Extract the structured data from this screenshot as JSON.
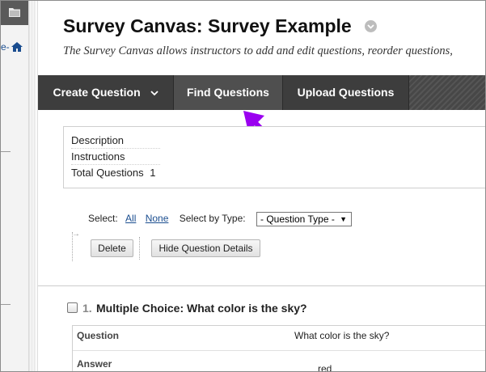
{
  "left_nav": {
    "cut_text": "e-",
    "icons": {
      "folder": "folder-icon",
      "home": "home-icon"
    }
  },
  "page": {
    "title": "Survey Canvas: Survey Example",
    "description": "The Survey Canvas allows instructors to add and edit questions, reorder questions,",
    "help_icon": "chevron-down-circle-icon"
  },
  "toolbar": {
    "create_question": "Create Question",
    "find_questions": "Find Questions",
    "upload_questions": "Upload Questions"
  },
  "annotation": {
    "arrow_color": "#9b00f0"
  },
  "summary": {
    "description_label": "Description",
    "instructions_label": "Instructions",
    "total_questions_label": "Total Questions",
    "total_questions_value": "1"
  },
  "selection": {
    "select_label": "Select:",
    "all_link": "All",
    "none_link": "None",
    "select_by_type_label": "Select by Type:",
    "question_type_value": "- Question Type -"
  },
  "actions": {
    "delete": "Delete",
    "hide_details": "Hide Question Details"
  },
  "question": {
    "number": "1.",
    "title": "Multiple Choice: What color is the sky?",
    "question_label": "Question",
    "question_value": "What color is the sky?",
    "answer_label": "Answer",
    "answer_value": "red"
  }
}
